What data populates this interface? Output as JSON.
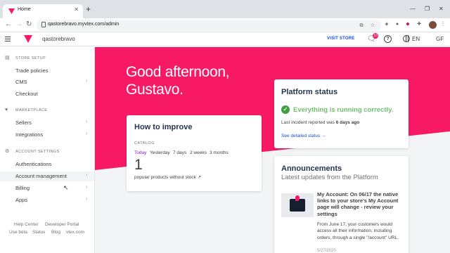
{
  "browser": {
    "tab_title": "Home",
    "url": "qastorebravo.myvtex.com/admin"
  },
  "header": {
    "store_name": "qastorebravo",
    "visit_store": "VISIT STORE",
    "notification_count": "10",
    "language": "EN",
    "user_initials": "GF"
  },
  "sidebar": {
    "sections": [
      {
        "title": "STORE SETUP",
        "items": [
          {
            "label": "Trade policies",
            "chevron": false
          },
          {
            "label": "CMS",
            "chevron": true
          },
          {
            "label": "Checkout",
            "chevron": false
          }
        ]
      },
      {
        "title": "MARKETPLACE",
        "items": [
          {
            "label": "Sellers",
            "chevron": true
          },
          {
            "label": "Integrations",
            "chevron": true
          }
        ]
      },
      {
        "title": "ACCOUNT SETTINGS",
        "items": [
          {
            "label": "Authentications",
            "chevron": false
          },
          {
            "label": "Account management",
            "chevron": true
          },
          {
            "label": "Billing",
            "chevron": true
          },
          {
            "label": "Apps",
            "chevron": true
          }
        ]
      }
    ],
    "footer": {
      "help_center": "Help Center",
      "developer_portal": "Developer Portal",
      "use_beta": "Use beta",
      "status": "Status",
      "blog": "Blog",
      "vtex_com": "vtex.com"
    }
  },
  "main": {
    "greeting_line1": "Good afternoon,",
    "greeting_line2": "Gustavo.",
    "how_to_improve": {
      "title": "How to improve",
      "category": "CATALOG",
      "periods": [
        "Today",
        "Yesterday",
        "7 days",
        "2 weeks",
        "3 months"
      ],
      "selected_period": "Today",
      "value": "1",
      "note": "popular products without stock ↗"
    },
    "platform_status": {
      "title": "Platform status",
      "message": "Everything is running correctly.",
      "incident_prefix": "Last incident reported was ",
      "incident_time": "6 days ago",
      "link": "See detailed status →"
    },
    "announcements": {
      "title": "Announcements",
      "subtitle": "Latest updates from the Platform",
      "item_title": "My Account: On 06/17 the native links to your store's My Account page will change - review your settings",
      "item_body": "From June 17, your customers would access all their information, including orders, through a single \"/account\" URL.",
      "item_date": "5/27/2020"
    }
  },
  "colors": {
    "brand_pink": "#f71963",
    "link_blue": "#134cd8",
    "success_green": "#3f9e43",
    "period_selected": "#8914cc"
  }
}
